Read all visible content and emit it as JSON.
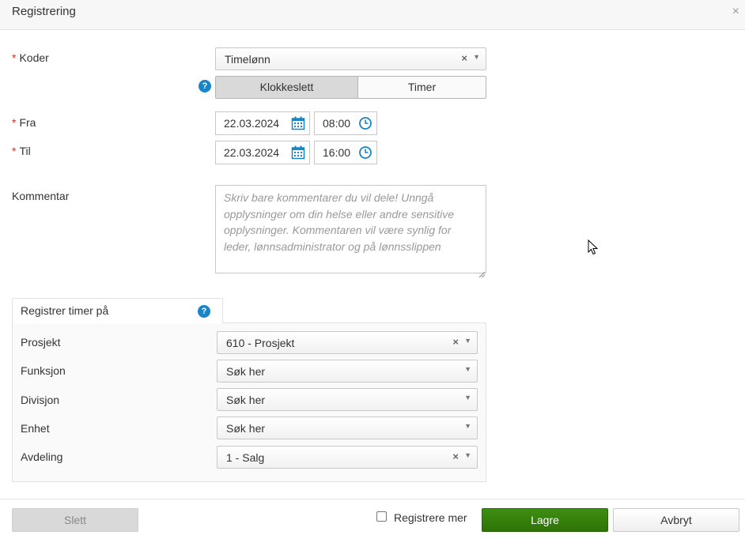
{
  "dialog": {
    "title": "Registrering"
  },
  "form": {
    "koder": {
      "label": "Koder",
      "value": "Timelønn"
    },
    "mode_toggle": {
      "active": "Klokkeslett",
      "inactive": "Timer"
    },
    "fra": {
      "label": "Fra",
      "date": "22.03.2024",
      "time": "08:00"
    },
    "til": {
      "label": "Til",
      "date": "22.03.2024",
      "time": "16:00"
    },
    "kommentar": {
      "label": "Kommentar",
      "placeholder": "Skriv bare kommentarer du vil dele! Unngå opplysninger om din helse eller andre sensitive opplysninger. Kommentaren vil være synlig for leder, lønnsadministrator og på lønnsslippen"
    }
  },
  "register_hours": {
    "tab_label": "Registrer timer på",
    "fields": [
      {
        "label": "Prosjekt",
        "value": "610 - Prosjekt",
        "clearable": true
      },
      {
        "label": "Funksjon",
        "value": "Søk her",
        "clearable": false
      },
      {
        "label": "Divisjon",
        "value": "Søk her",
        "clearable": false
      },
      {
        "label": "Enhet",
        "value": "Søk her",
        "clearable": false
      },
      {
        "label": "Avdeling",
        "value": "1 - Salg",
        "clearable": true
      }
    ]
  },
  "footer": {
    "delete_label": "Slett",
    "register_more_label": "Registrere mer",
    "save_label": "Lagre",
    "cancel_label": "Avbryt"
  },
  "symbols": {
    "required": "*",
    "close": "×",
    "clear": "×",
    "caret": "▼",
    "help": "?"
  },
  "colors": {
    "accent": "#1785c8",
    "save_button": "#3a8a0e",
    "required": "#c0392b"
  }
}
